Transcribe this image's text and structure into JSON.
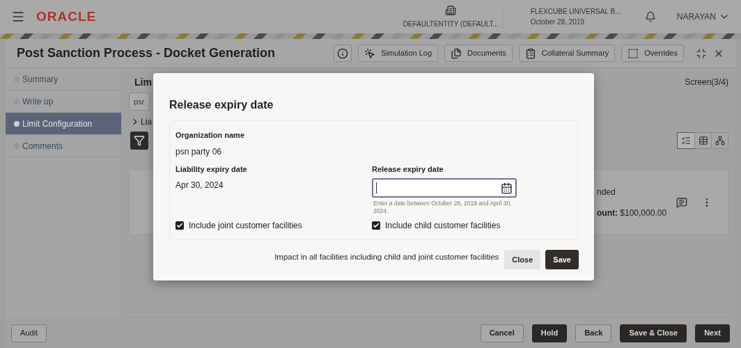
{
  "header": {
    "logo": "ORACLE",
    "entity": "DEFAULTENTITY (DEFAULT...",
    "app": "FLEXCUBE UNIVERSAL B...",
    "date": "October 28, 2019",
    "user": "NARAYAN"
  },
  "title_bar": {
    "title": "Post Sanction Process - Docket Generation",
    "actions": [
      {
        "kind": "info"
      },
      {
        "kind": "simulation",
        "label": "Simulation Log"
      },
      {
        "kind": "documents",
        "label": "Documents"
      },
      {
        "kind": "collateral",
        "label": "Collateral Summary"
      },
      {
        "kind": "overrides",
        "label": "Overrides"
      }
    ]
  },
  "sidebar": {
    "items": [
      {
        "label": "Summary",
        "selected": false
      },
      {
        "label": "Write up",
        "selected": false
      },
      {
        "label": "Limit Configuration",
        "selected": true
      },
      {
        "label": "Comments",
        "selected": false
      }
    ]
  },
  "content": {
    "heading": "Lim",
    "search_value": "psr",
    "section": "Lia",
    "screen": "Screen(3/4)",
    "views": [
      {
        "kind": "list",
        "selected": true
      },
      {
        "kind": "table",
        "selected": false
      },
      {
        "kind": "tree",
        "selected": false
      }
    ],
    "card": {
      "status": "nded",
      "amount_label": "ount:",
      "amount": "$100,000.00"
    }
  },
  "dialog": {
    "title": "Release expiry date",
    "organization": {
      "label": "Organization name",
      "value": "psn party 06"
    },
    "liability": {
      "label": "Liability expiry date",
      "value": "Apr 30, 2024"
    },
    "release": {
      "label": "Release expiry date",
      "hint": "Enter a date between October 28, 2019 and April 30, 2024."
    },
    "checkboxes": [
      {
        "label": "Include joint customer facilities",
        "checked": true
      },
      {
        "label": "Include child customer facilities",
        "checked": true
      }
    ],
    "note": "Impact in all facilities including child and joint customer facilities",
    "buttons": [
      {
        "label": "Close",
        "kind": "secondary"
      },
      {
        "label": "Save",
        "kind": "primary"
      }
    ]
  },
  "footer": {
    "left": [
      {
        "label": "Audit",
        "kind": "outline"
      }
    ],
    "right": [
      {
        "label": "Cancel",
        "kind": "outline"
      },
      {
        "label": "Hold",
        "kind": "dark"
      },
      {
        "label": "Back",
        "kind": "outline"
      },
      {
        "label": "Save & Close",
        "kind": "dark"
      },
      {
        "label": "Next",
        "kind": "dark"
      }
    ]
  }
}
